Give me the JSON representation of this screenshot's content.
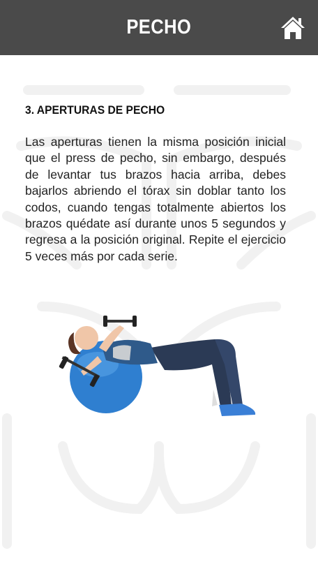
{
  "header": {
    "title": "PECHO",
    "home_icon": "home-icon"
  },
  "exercise": {
    "title": "3. APERTURAS DE PECHO",
    "description": "Las aperturas tienen la misma posición inicial que el press de pecho, sin embargo, después de levantar tus brazos hacia arriba, debes bajarlos abriendo el tórax sin doblar tanto los codos, cuando tengas totalmente abiertos los brazos quédate así durante unos 5 segundos y regresa a la posición original. Repite el ejercicio 5 veces más por cada serie."
  },
  "colors": {
    "header_bg": "#4a4a4a",
    "ball": "#2f7fd0",
    "pants": "#2b3a55"
  }
}
